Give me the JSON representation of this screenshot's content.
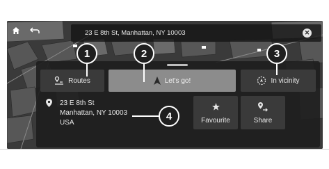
{
  "destination": {
    "address": "23 E 8th St, Manhattan, NY 10003"
  },
  "actions": {
    "routes_label": "Routes",
    "go_label": "Let's go!",
    "vicinity_label": "In vicinity",
    "favourite_label": "Favourite",
    "share_label": "Share"
  },
  "address": {
    "line1": "23 E 8th St",
    "line2": "Manhattan, NY 10003",
    "line3": "USA"
  },
  "callouts": [
    "1",
    "2",
    "3",
    "4"
  ],
  "icons": {
    "home": "home-icon",
    "back": "back-arrow-icon",
    "clear": "close-icon",
    "routes": "routes-icon",
    "go": "navigation-arrow-icon",
    "vicinity": "vicinity-icon",
    "pin": "location-pin-icon",
    "favourite": "star-icon",
    "share": "share-location-icon"
  },
  "colors": {
    "panel": "#1e1e1e",
    "go_button": "#8c8c8c",
    "callout": "#1f1f1f"
  }
}
